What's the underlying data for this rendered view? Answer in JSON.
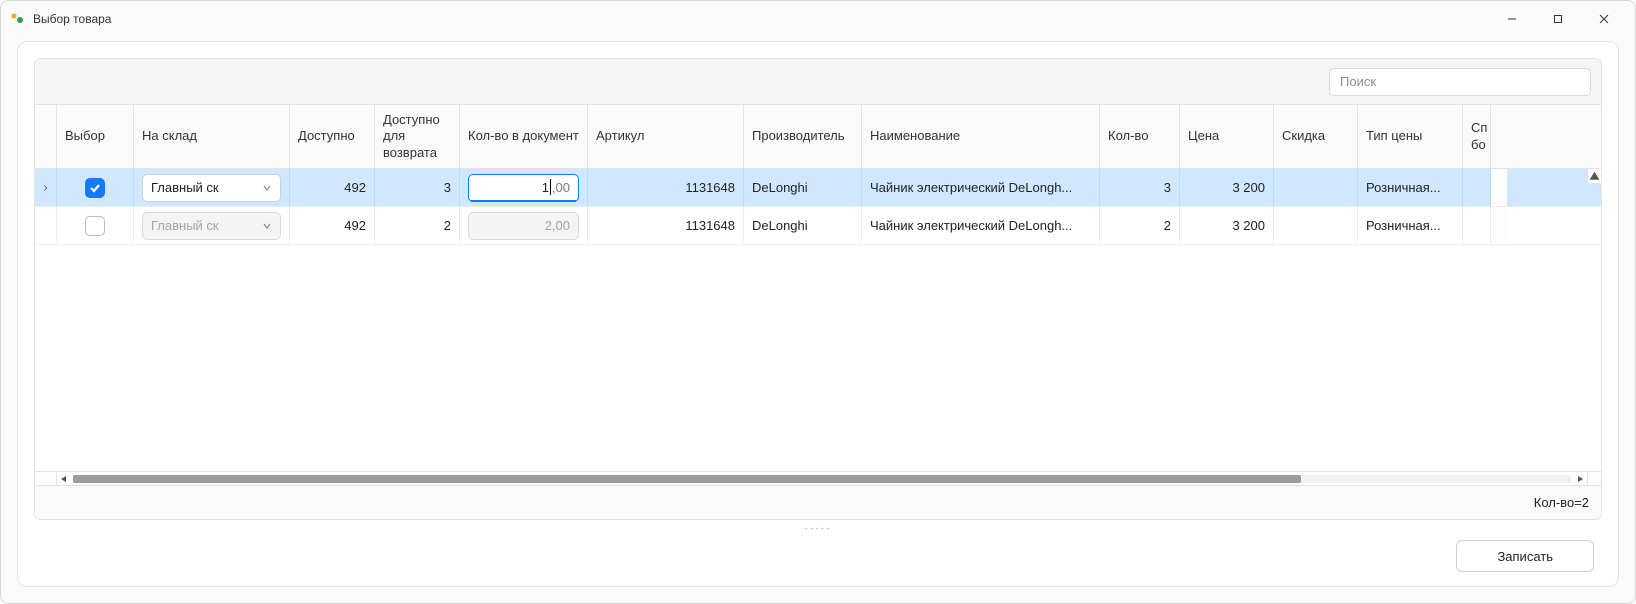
{
  "window": {
    "title": "Выбор товара"
  },
  "toolbar": {
    "search_placeholder": "Поиск"
  },
  "columns": {
    "select": "Выбор",
    "warehouse": "На склад",
    "available": "Доступно",
    "avail_return": "Доступно для возврата",
    "qty_doc": "Кол-во в документ",
    "article": "Артикул",
    "manufacturer": "Производитель",
    "name": "Наименование",
    "qty": "Кол-во",
    "price": "Цена",
    "discount": "Скидка",
    "price_type": "Тип цены",
    "spare": "Сп бо"
  },
  "rows": [
    {
      "selected": true,
      "checked": true,
      "warehouse": "Главный ск",
      "available": "492",
      "avail_return": "3",
      "qty_doc_typed": "1",
      "qty_doc_suffix": ",00",
      "article": "1131648",
      "manufacturer": "DeLonghi",
      "name": "Чайник электрический DeLongh...",
      "qty": "3",
      "price": "3 200",
      "discount": "",
      "price_type": "Розничная..."
    },
    {
      "selected": false,
      "checked": false,
      "warehouse": "Главный ск",
      "available": "492",
      "avail_return": "2",
      "qty_doc_full": "2,00",
      "article": "1131648",
      "manufacturer": "DeLonghi",
      "name": "Чайник электрический DeLongh...",
      "qty": "2",
      "price": "3 200",
      "discount": "",
      "price_type": "Розничная..."
    }
  ],
  "footer": {
    "summary": "Кол-во=2"
  },
  "actions": {
    "submit": "Записать"
  },
  "scroll": {
    "hthumb_pct": 82
  }
}
